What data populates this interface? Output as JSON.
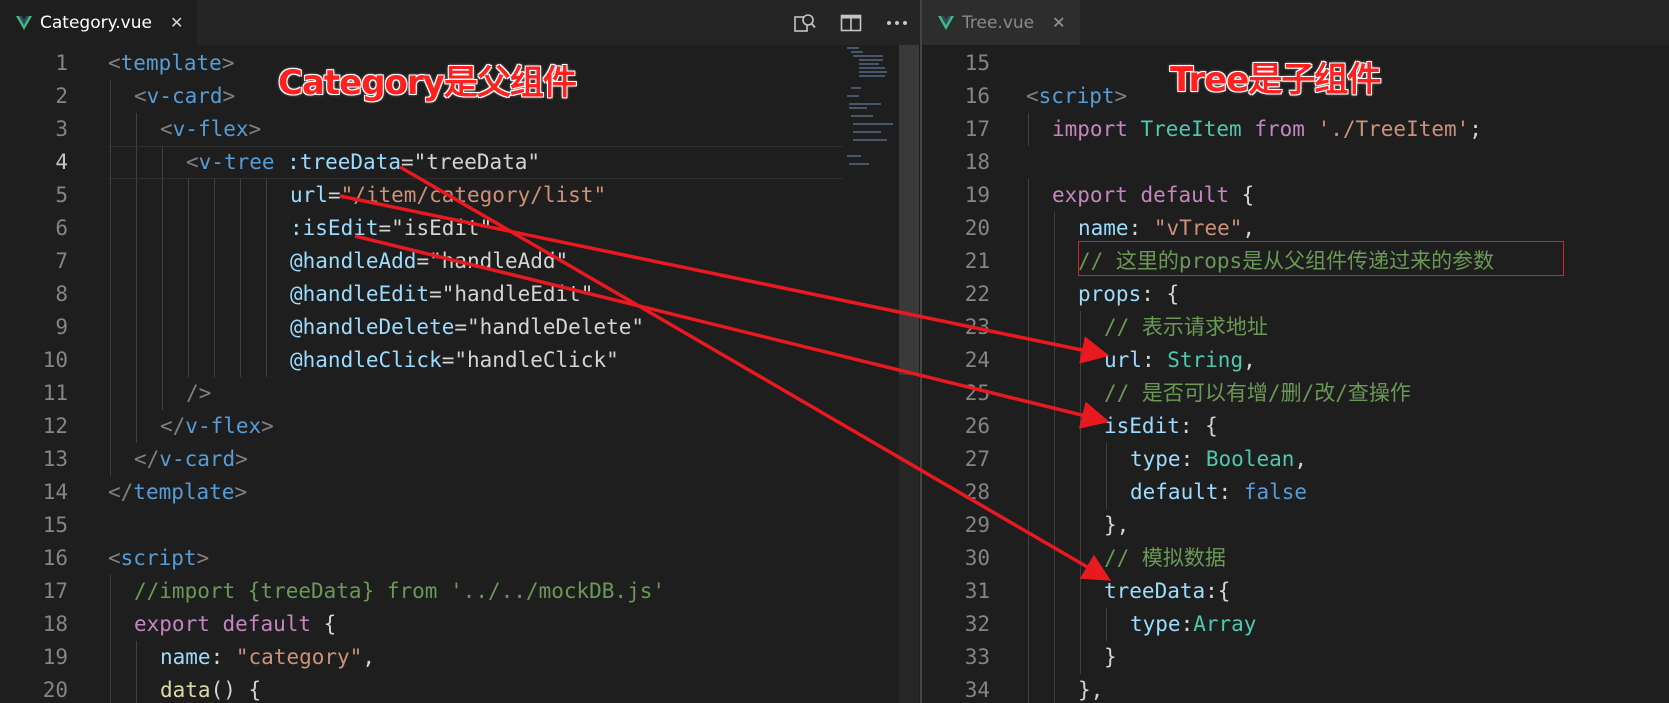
{
  "left": {
    "tab": {
      "title": "Category.vue",
      "close": "✕"
    },
    "actions": [
      "search-diff-icon",
      "split-editor-icon",
      "more-actions-icon"
    ],
    "current_line": 4,
    "annotation": "Category是父组件",
    "lines": [
      {
        "n": "1",
        "indent": 0,
        "tokens": [
          [
            "<",
            "tag"
          ],
          [
            "template",
            "tn"
          ],
          [
            ">",
            "tag"
          ]
        ]
      },
      {
        "n": "2",
        "indent": 1,
        "tokens": [
          [
            "<",
            "tag"
          ],
          [
            "v-card",
            "tn"
          ],
          [
            ">",
            "tag"
          ]
        ]
      },
      {
        "n": "3",
        "indent": 2,
        "tokens": [
          [
            "<",
            "tag"
          ],
          [
            "v-flex",
            "tn"
          ],
          [
            ">",
            "tag"
          ]
        ]
      },
      {
        "n": "4",
        "indent": 3,
        "tokens": [
          [
            "<",
            "tag"
          ],
          [
            "v-tree",
            "tn"
          ],
          [
            " ",
            "txt"
          ],
          [
            ":treeData",
            "at"
          ],
          [
            "=",
            "txt"
          ],
          [
            "\"treeData\"",
            "txt"
          ]
        ]
      },
      {
        "n": "5",
        "indent": 7,
        "tokens": [
          [
            "url",
            "at"
          ],
          [
            "=",
            "txt"
          ],
          [
            "\"/item/category/list\"",
            "str"
          ]
        ]
      },
      {
        "n": "6",
        "indent": 7,
        "tokens": [
          [
            ":isEdit",
            "at"
          ],
          [
            "=",
            "txt"
          ],
          [
            "\"isEdit\"",
            "txt"
          ]
        ]
      },
      {
        "n": "7",
        "indent": 7,
        "tokens": [
          [
            "@handleAdd",
            "at"
          ],
          [
            "=",
            "txt"
          ],
          [
            "\"handleAdd\"",
            "txt"
          ]
        ]
      },
      {
        "n": "8",
        "indent": 7,
        "tokens": [
          [
            "@handleEdit",
            "at"
          ],
          [
            "=",
            "txt"
          ],
          [
            "\"handleEdit\"",
            "txt"
          ]
        ]
      },
      {
        "n": "9",
        "indent": 7,
        "tokens": [
          [
            "@handleDelete",
            "at"
          ],
          [
            "=",
            "txt"
          ],
          [
            "\"handleDelete\"",
            "txt"
          ]
        ]
      },
      {
        "n": "10",
        "indent": 7,
        "tokens": [
          [
            "@handleClick",
            "at"
          ],
          [
            "=",
            "txt"
          ],
          [
            "\"handleClick\"",
            "txt"
          ]
        ]
      },
      {
        "n": "11",
        "indent": 3,
        "tokens": [
          [
            "/>",
            "tag"
          ]
        ]
      },
      {
        "n": "12",
        "indent": 2,
        "tokens": [
          [
            "</",
            "tag"
          ],
          [
            "v-flex",
            "tn"
          ],
          [
            ">",
            "tag"
          ]
        ]
      },
      {
        "n": "13",
        "indent": 1,
        "tokens": [
          [
            "</",
            "tag"
          ],
          [
            "v-card",
            "tn"
          ],
          [
            ">",
            "tag"
          ]
        ]
      },
      {
        "n": "14",
        "indent": 0,
        "tokens": [
          [
            "</",
            "tag"
          ],
          [
            "template",
            "tn"
          ],
          [
            ">",
            "tag"
          ]
        ]
      },
      {
        "n": "15",
        "indent": 0,
        "tokens": []
      },
      {
        "n": "16",
        "indent": 0,
        "tokens": [
          [
            "<",
            "tag"
          ],
          [
            "script",
            "tn"
          ],
          [
            ">",
            "tag"
          ]
        ]
      },
      {
        "n": "17",
        "indent": 1,
        "tokens": [
          [
            "//import {treeData} from '../../mockDB.js'",
            "com"
          ]
        ]
      },
      {
        "n": "18",
        "indent": 1,
        "tokens": [
          [
            "export",
            "kw"
          ],
          [
            " ",
            "txt"
          ],
          [
            "default",
            "kw"
          ],
          [
            " {",
            "txt"
          ]
        ]
      },
      {
        "n": "19",
        "indent": 2,
        "tokens": [
          [
            "name",
            "at"
          ],
          [
            ": ",
            "txt"
          ],
          [
            "\"category\"",
            "str"
          ],
          [
            ",",
            "txt"
          ]
        ]
      },
      {
        "n": "20",
        "indent": 2,
        "tokens": [
          [
            "data",
            "fn"
          ],
          [
            "() {",
            "txt"
          ]
        ]
      }
    ]
  },
  "right": {
    "tab": {
      "title": "Tree.vue",
      "close": "✕"
    },
    "annotation": "Tree是子组件",
    "lines": [
      {
        "n": "15",
        "indent": 0,
        "tokens": []
      },
      {
        "n": "16",
        "indent": 0,
        "tokens": [
          [
            "<",
            "tag"
          ],
          [
            "script",
            "tn"
          ],
          [
            ">",
            "tag"
          ]
        ]
      },
      {
        "n": "17",
        "indent": 1,
        "tokens": [
          [
            "import",
            "kw"
          ],
          [
            " ",
            "txt"
          ],
          [
            "TreeItem",
            "cls"
          ],
          [
            " ",
            "txt"
          ],
          [
            "from",
            "kw"
          ],
          [
            " ",
            "txt"
          ],
          [
            "'./TreeItem'",
            "str"
          ],
          [
            ";",
            "txt"
          ]
        ]
      },
      {
        "n": "18",
        "indent": 0,
        "tokens": []
      },
      {
        "n": "19",
        "indent": 1,
        "tokens": [
          [
            "export",
            "kw"
          ],
          [
            " ",
            "txt"
          ],
          [
            "default",
            "kw"
          ],
          [
            " {",
            "txt"
          ]
        ]
      },
      {
        "n": "20",
        "indent": 2,
        "tokens": [
          [
            "name",
            "at"
          ],
          [
            ": ",
            "txt"
          ],
          [
            "\"vTree\"",
            "str"
          ],
          [
            ",",
            "txt"
          ]
        ]
      },
      {
        "n": "21",
        "indent": 2,
        "tokens": [
          [
            "// 这里的props是从父组件传递过来的参数",
            "com"
          ]
        ]
      },
      {
        "n": "22",
        "indent": 2,
        "tokens": [
          [
            "props",
            "at"
          ],
          [
            ": {",
            "txt"
          ]
        ]
      },
      {
        "n": "23",
        "indent": 3,
        "tokens": [
          [
            "// 表示请求地址",
            "com"
          ]
        ]
      },
      {
        "n": "24",
        "indent": 3,
        "tokens": [
          [
            "url",
            "at"
          ],
          [
            ": ",
            "txt"
          ],
          [
            "String",
            "cls"
          ],
          [
            ",",
            "txt"
          ]
        ]
      },
      {
        "n": "25",
        "indent": 3,
        "tokens": [
          [
            "// 是否可以有增/删/改/查操作",
            "com"
          ]
        ]
      },
      {
        "n": "26",
        "indent": 3,
        "tokens": [
          [
            "isEdit",
            "at"
          ],
          [
            ": {",
            "txt"
          ]
        ]
      },
      {
        "n": "27",
        "indent": 4,
        "tokens": [
          [
            "type",
            "at"
          ],
          [
            ": ",
            "txt"
          ],
          [
            "Boolean",
            "cls"
          ],
          [
            ",",
            "txt"
          ]
        ]
      },
      {
        "n": "28",
        "indent": 4,
        "tokens": [
          [
            "default",
            "at"
          ],
          [
            ": ",
            "txt"
          ],
          [
            "false",
            "lit"
          ]
        ]
      },
      {
        "n": "29",
        "indent": 3,
        "tokens": [
          [
            "},",
            "txt"
          ]
        ]
      },
      {
        "n": "30",
        "indent": 3,
        "tokens": [
          [
            "// 模拟数据",
            "com"
          ]
        ]
      },
      {
        "n": "31",
        "indent": 3,
        "tokens": [
          [
            "treeData",
            "at"
          ],
          [
            ":{",
            "txt"
          ]
        ]
      },
      {
        "n": "32",
        "indent": 4,
        "tokens": [
          [
            "type",
            "at"
          ],
          [
            ":",
            "txt"
          ],
          [
            "Array",
            "cls"
          ]
        ]
      },
      {
        "n": "33",
        "indent": 3,
        "tokens": [
          [
            "}",
            "txt"
          ]
        ]
      },
      {
        "n": "34",
        "indent": 2,
        "tokens": [
          [
            "},",
            "txt"
          ]
        ]
      }
    ]
  },
  "colors": {
    "annotation_red": "#ff2020",
    "arrow_red": "#e8191f",
    "editor_bg": "#1e1e1e"
  }
}
